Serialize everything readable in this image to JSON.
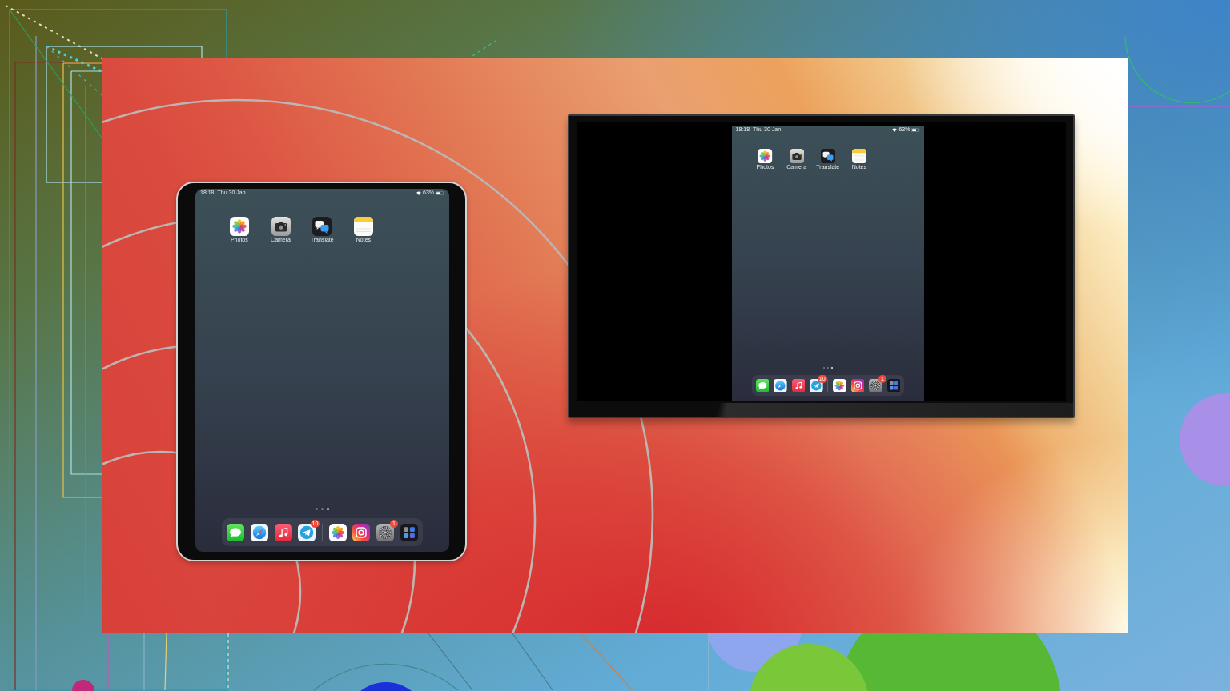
{
  "tablet": {
    "status_bar": {
      "time": "18:18",
      "date": "Thu 30 Jan",
      "battery": "63%"
    },
    "apps": [
      {
        "kind": "flower",
        "label": "Photos"
      },
      {
        "kind": "camera",
        "label": "Camera"
      },
      {
        "kind": "bubbles",
        "label": "Translate"
      },
      {
        "kind": "notepad",
        "label": "Notes"
      }
    ],
    "page_dots": [
      {
        "selected": false
      },
      {
        "selected": false
      },
      {
        "selected": true
      }
    ],
    "dock": {
      "apps": [
        {
          "kind": "chat"
        },
        {
          "kind": "compass"
        },
        {
          "kind": "note"
        },
        {
          "kind": "plane",
          "badge": "10"
        }
      ],
      "recent_apps": [
        {
          "kind": "flower"
        },
        {
          "kind": "lens"
        },
        {
          "kind": "gear",
          "badge": "1"
        },
        {
          "kind": "grid"
        }
      ]
    }
  },
  "tv": {
    "mirrored_screen": {
      "status_bar": {
        "time": "18:18",
        "date": "Thu 30 Jan",
        "battery": "63%"
      },
      "apps": [
        {
          "kind": "flower",
          "label": "Photos"
        },
        {
          "kind": "camera",
          "label": "Camera"
        },
        {
          "kind": "bubbles",
          "label": "Translate"
        },
        {
          "kind": "notepad",
          "label": "Notes"
        }
      ],
      "page_dots": [
        {
          "selected": false
        },
        {
          "selected": false
        },
        {
          "selected": true
        }
      ],
      "dock": {
        "apps": [
          {
            "kind": "chat"
          },
          {
            "kind": "compass"
          },
          {
            "kind": "note"
          },
          {
            "kind": "plane",
            "badge": "10"
          }
        ],
        "recent_apps": [
          {
            "kind": "flower"
          },
          {
            "kind": "lens"
          },
          {
            "kind": "gear",
            "badge": "1"
          },
          {
            "kind": "grid"
          }
        ]
      }
    }
  }
}
